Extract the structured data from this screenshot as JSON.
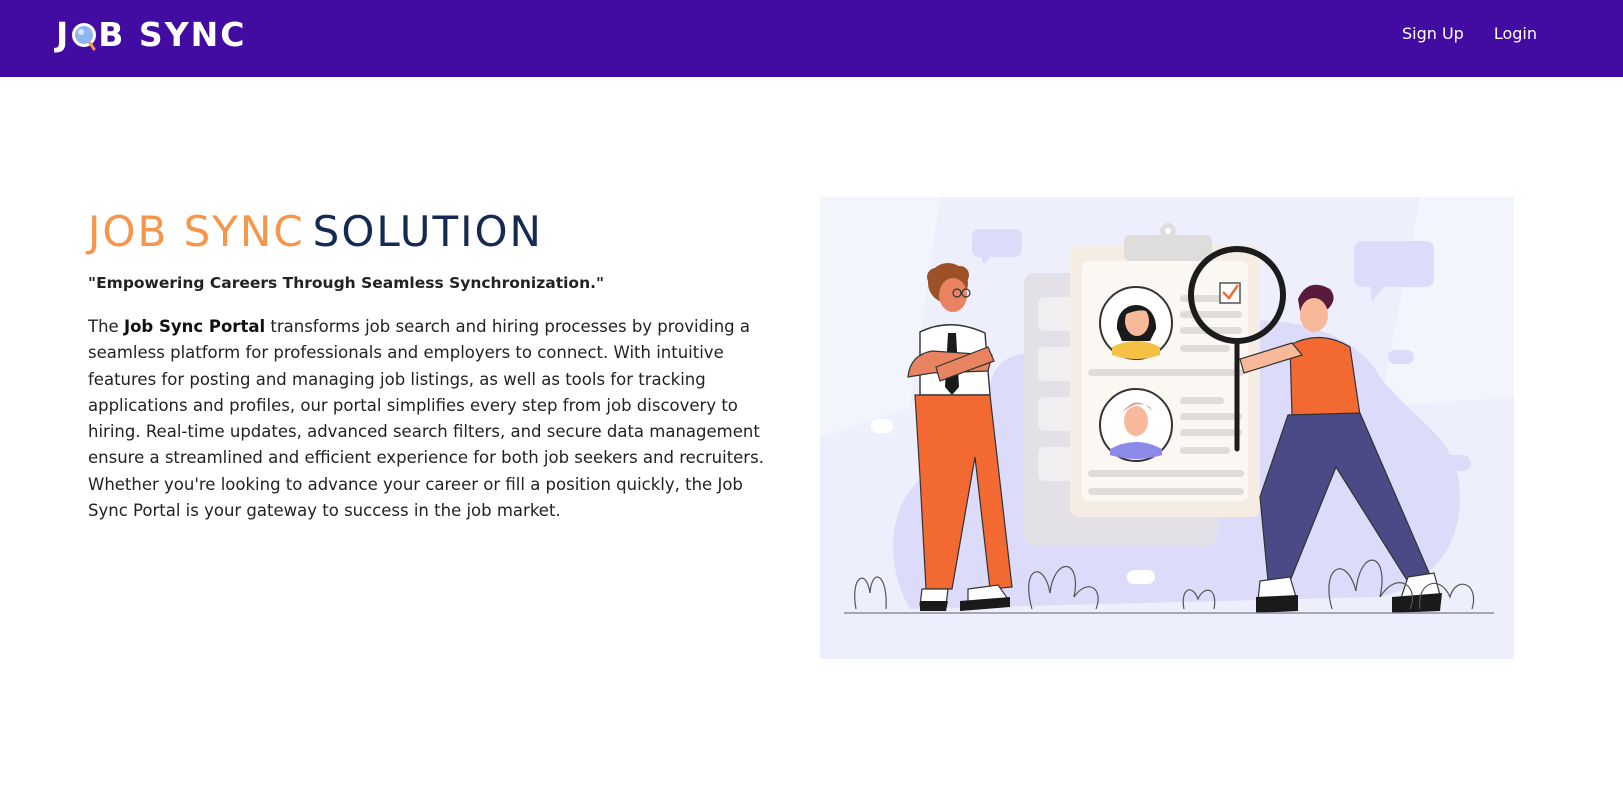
{
  "navbar": {
    "logo": {
      "text_before": "J",
      "text_after": "B SYNC",
      "icon": "magnifier-o-icon"
    },
    "links": [
      {
        "label": "Sign Up"
      },
      {
        "label": "Login"
      }
    ],
    "background_color": "#420ca2"
  },
  "hero": {
    "title_part1": "JOB SYNC",
    "title_part2": "SOLUTION",
    "title_color1": "#f7964a",
    "title_color2": "#152a52",
    "tagline": "\"Empowering Careers Through Seamless Synchronization.\"",
    "description": {
      "prefix": "The ",
      "bold": "Job Sync Portal",
      "rest": " transforms job search and hiring processes by providing a seamless platform for professionals and employers to connect. With intuitive features for posting and managing job listings, as well as tools for tracking applications and profiles, our portal simplifies every step from job discovery to hiring. Real-time updates, advanced search filters, and secure data management ensure a streamlined and efficient experience for both job seekers and recruiters. Whether you're looking to advance your career or fill a position quickly, the Job Sync Portal is your gateway to success in the job market."
    }
  },
  "illustration": {
    "icon": "recruitment-illustration",
    "checkbox_state": "checked"
  }
}
